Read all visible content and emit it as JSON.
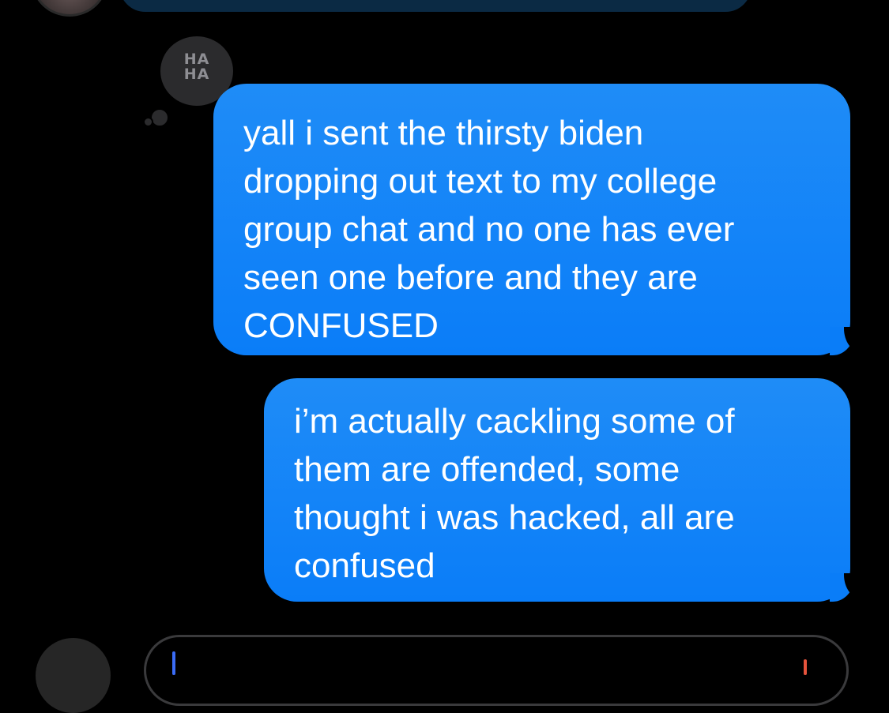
{
  "reaction": {
    "icon": "haha-tapback-icon",
    "text": "HA\nHA"
  },
  "messages": [
    {
      "direction": "outgoing",
      "text": "yall i sent the thirsty biden\ndropping out text to my college\ngroup chat and no one has ever\nseen one before and they are\nCONFUSED"
    },
    {
      "direction": "outgoing",
      "text": "i’m actually cackling some of\nthem are offended, some\nthought i was hacked, all are\nconfused"
    }
  ],
  "colors": {
    "background": "#000000",
    "outgoing_bubble": "#1283f8",
    "tapback_bg": "#2b2b2d",
    "tapback_text": "#8e8e93"
  }
}
